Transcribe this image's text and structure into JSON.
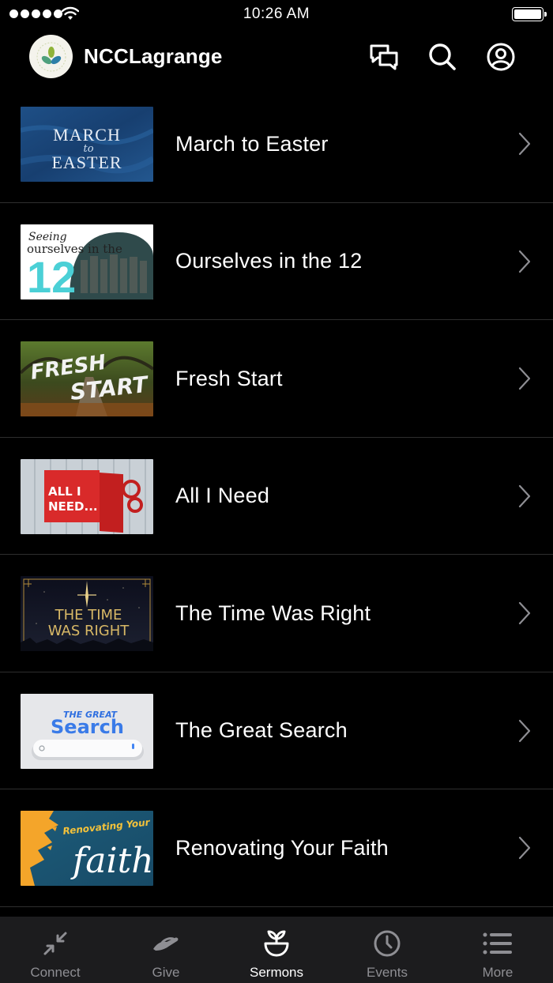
{
  "status": {
    "time": "10:26 AM"
  },
  "header": {
    "title": "NCCLagrange"
  },
  "sermons": [
    {
      "title": "March to Easter",
      "art": [
        "MARCH",
        "to",
        "EASTER"
      ]
    },
    {
      "title": "Ourselves in the 12",
      "art": [
        "Seeing",
        "ourselves in the",
        "12"
      ]
    },
    {
      "title": "Fresh Start",
      "art": [
        "FRESH",
        "START"
      ]
    },
    {
      "title": "All I Need",
      "art": [
        "ALL I",
        "NEED..."
      ]
    },
    {
      "title": "The Time Was Right",
      "art": [
        "THE TIME",
        "WAS RIGHT"
      ]
    },
    {
      "title": "The Great Search",
      "art": [
        "THE GREAT",
        "Search"
      ]
    },
    {
      "title": "Renovating Your Faith",
      "art": [
        "Renovating Your",
        "faith"
      ]
    }
  ],
  "tabs": [
    {
      "label": "Connect",
      "icon": "connect-icon"
    },
    {
      "label": "Give",
      "icon": "give-icon"
    },
    {
      "label": "Sermons",
      "icon": "sermons-icon"
    },
    {
      "label": "Events",
      "icon": "events-icon"
    },
    {
      "label": "More",
      "icon": "more-icon"
    }
  ],
  "colors": {
    "background": "#000000",
    "tabbar": "#1c1c1e",
    "inactive": "#8e8e93",
    "active": "#ffffff",
    "divider": "#2e2e2e"
  }
}
